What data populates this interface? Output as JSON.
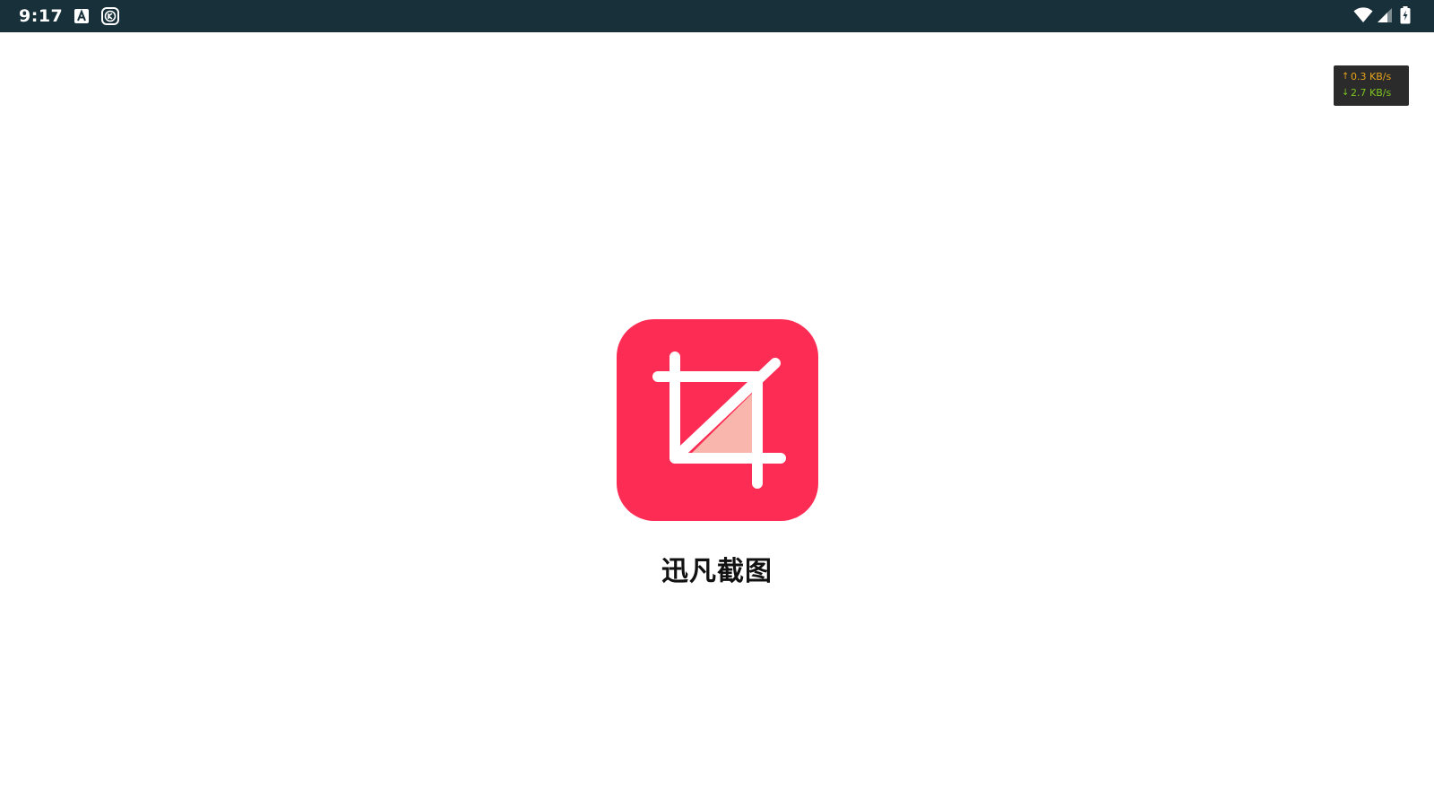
{
  "status_bar": {
    "time": "9:17",
    "background": "#17303a",
    "notification_icons": [
      "a-badge-icon",
      "k-app-icon"
    ],
    "system_icons": [
      "wifi-icon",
      "cell-signal-icon",
      "battery-charging-icon"
    ]
  },
  "net_speed": {
    "upload_arrow": "↑",
    "upload": "0.3 KB/s",
    "download_arrow": "↓",
    "download": "2.7 KB/s",
    "upload_color": "#e8a21c",
    "download_color": "#7cc41f"
  },
  "splash": {
    "app_icon": "crop-icon",
    "app_name": "迅凡截图",
    "icon_background": "#fd2c55",
    "icon_accent": "#f9b6ad"
  }
}
